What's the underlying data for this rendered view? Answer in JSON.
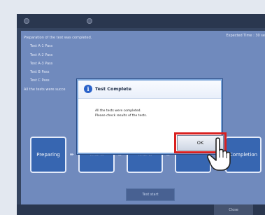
{
  "log": {
    "header": "Preparation of the test was completed.",
    "items": [
      "Test A-1 Pass",
      "Test A-2 Pass",
      "Test A-3 Pass",
      "Test B Pass",
      "Test C Pass"
    ],
    "footer": "All the tests were succe"
  },
  "expected_time": "Expected Time : 30 se",
  "steps": {
    "preparing": "Preparing",
    "test_a": "Test A",
    "test_b": "Test B",
    "completion": "Completion"
  },
  "buttons": {
    "test_start": "Test start",
    "close": "Close"
  },
  "dialog": {
    "title": "Test Complete",
    "line1": "All the tests were completed.",
    "line2": "Please check results of the tests.",
    "ok": "OK"
  },
  "colors": {
    "panel": "#6b86bb",
    "step_fill": "#2d5fae",
    "highlight": "#d9201f"
  }
}
